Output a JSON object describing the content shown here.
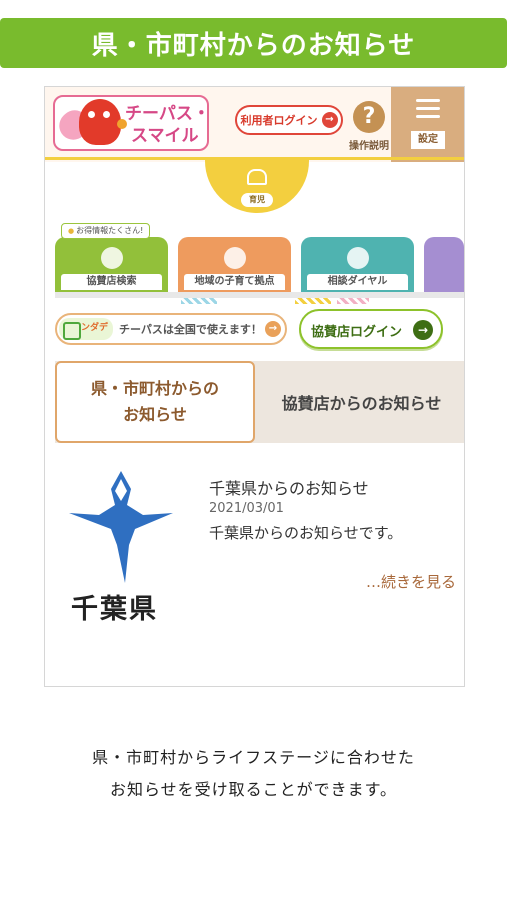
{
  "banner": {
    "title": "県・市町村からのお知らせ"
  },
  "app": {
    "logo": {
      "line1": "チーパス・",
      "line2": "スマイル"
    },
    "login_label": "利用者ログイン",
    "help_label": "操作説明",
    "help_glyph": "?",
    "settings_label": "設定",
    "ikuji_label": "育児",
    "badge": "お得情報たくさん!",
    "categories": [
      {
        "label": "協賛店検索"
      },
      {
        "label": "地域の子育て拠点"
      },
      {
        "label": "相談ダイヤル"
      },
      {
        "label": ""
      }
    ],
    "pass_banner": {
      "mini_text": "ンダデ",
      "label": "チーパスは全国で使えます！"
    },
    "shop_login": "協賛店ログイン",
    "arrow_glyph": "→"
  },
  "tabs": {
    "active_line1": "県・市町村からの",
    "active_line2": "お知らせ",
    "other": "協賛店からのお知らせ"
  },
  "news": {
    "emblem_label": "千葉県",
    "title": "千葉県からのお知らせ",
    "date": "2021/03/01",
    "body": "千葉県からのお知らせです。",
    "more": "…続きを見る"
  },
  "description": {
    "line1": "県・市町村からライフステージに合わせた",
    "line2": "お知らせを受け取ることができます。"
  },
  "colors": {
    "banner": "#79bb2d",
    "emblem": "#2f6fc1",
    "accent": "#e0463a"
  }
}
